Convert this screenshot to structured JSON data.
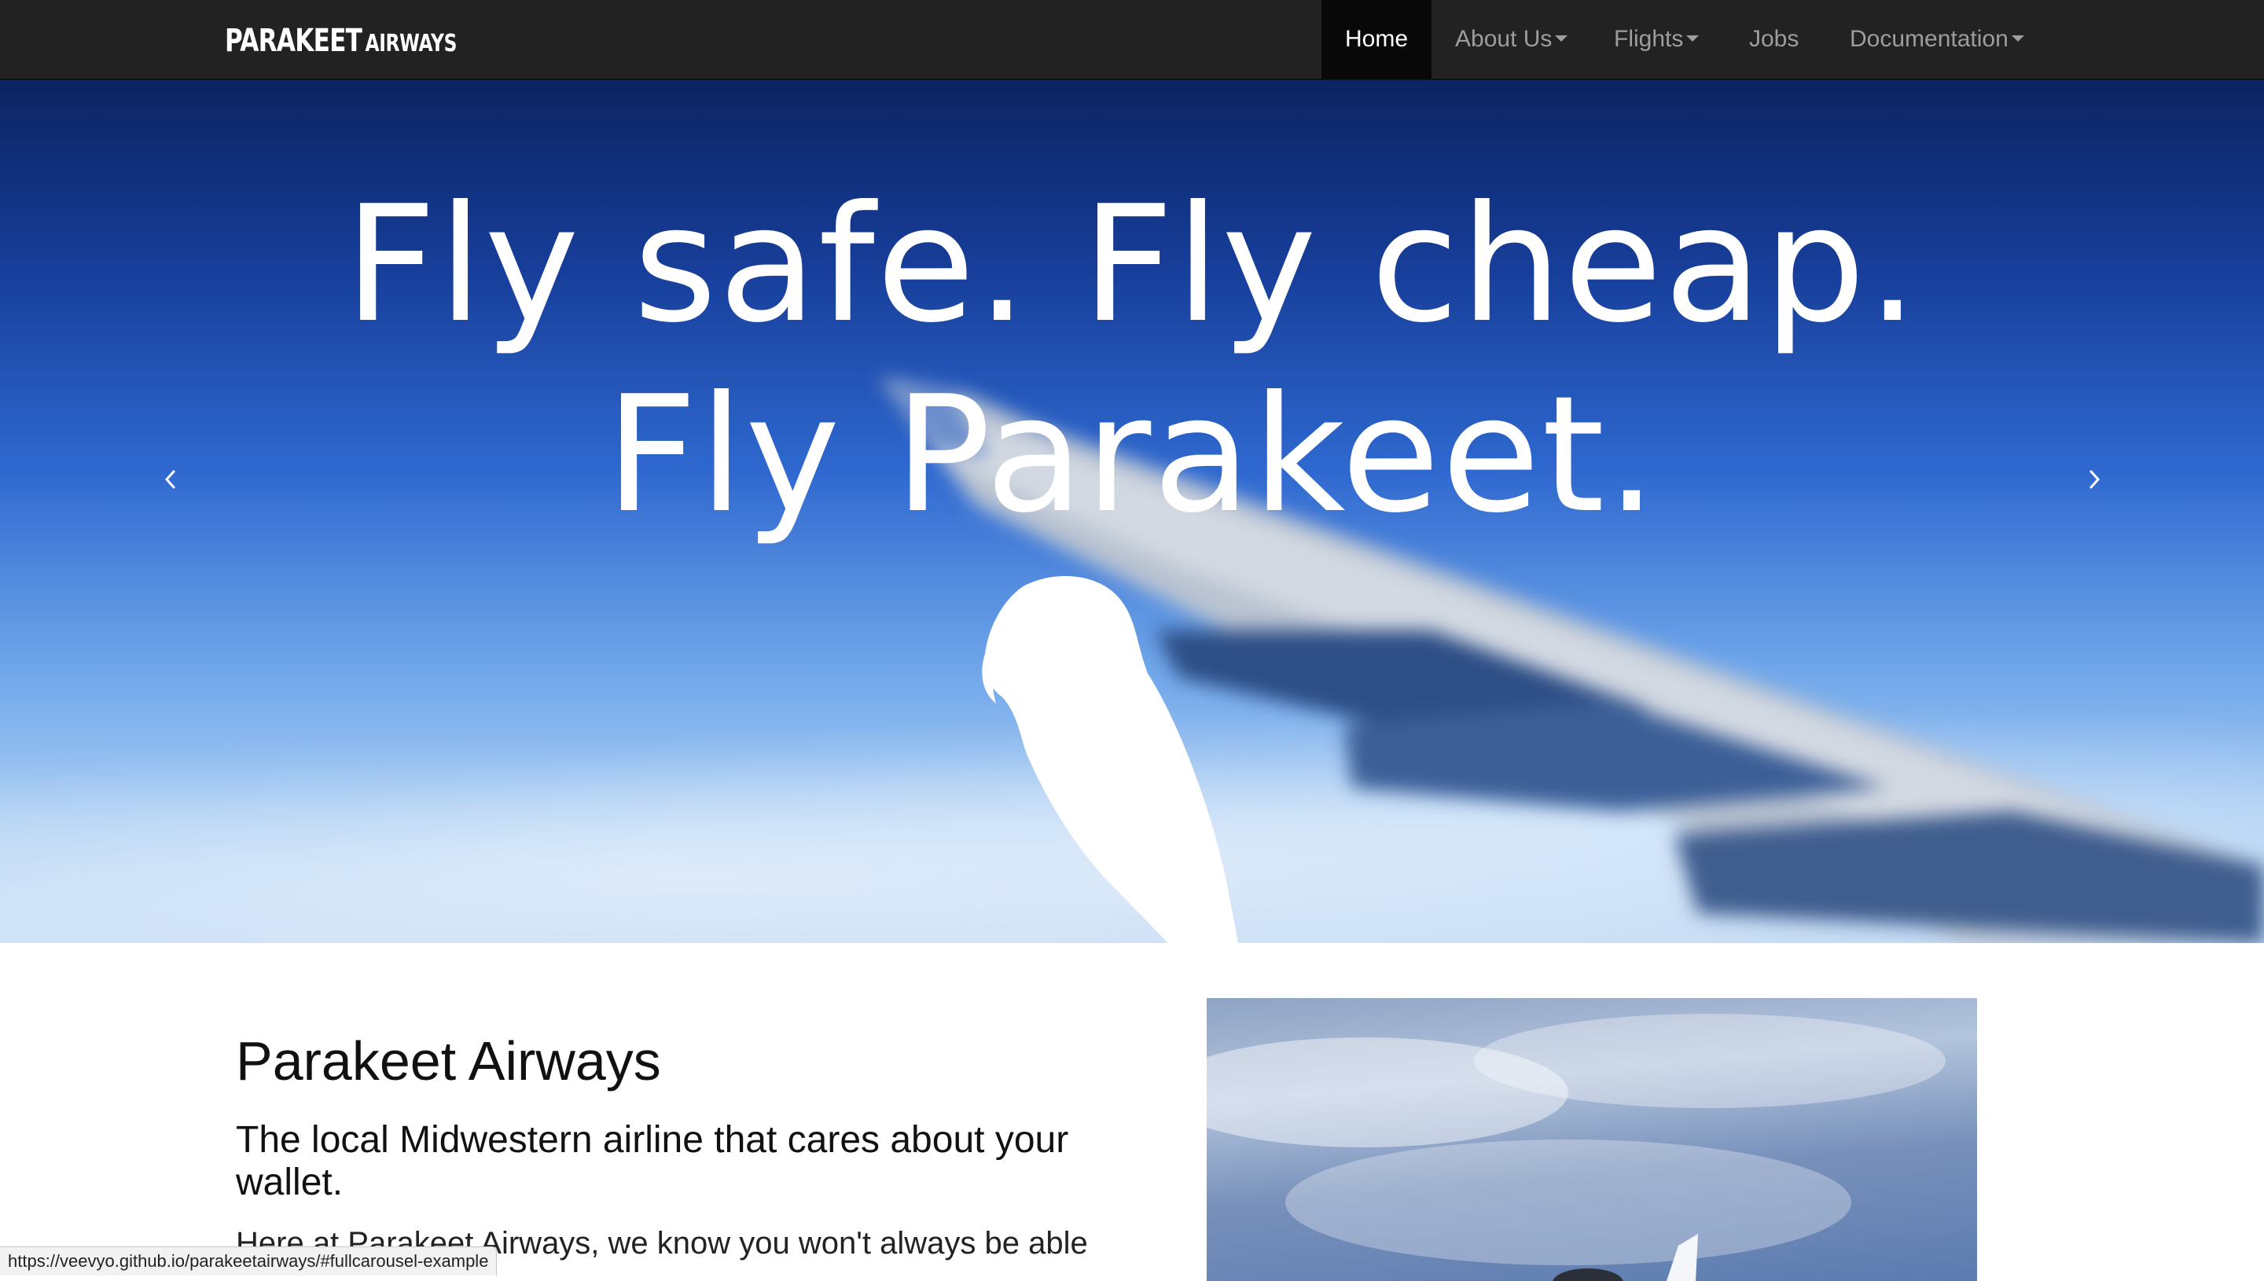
{
  "colors": {
    "navbar_bg": "#222222",
    "nav_active_bg": "#080808",
    "nav_text": "#9d9d9d",
    "hero_text": "#ffffff"
  },
  "navbar": {
    "brand_main": "PARAKEET",
    "brand_sub": "AIRWAYS",
    "items": [
      {
        "label": "Home",
        "active": true,
        "dropdown": false
      },
      {
        "label": "About Us",
        "active": false,
        "dropdown": true
      },
      {
        "label": "Flights",
        "active": false,
        "dropdown": true
      },
      {
        "label": "Jobs",
        "active": false,
        "dropdown": false
      },
      {
        "label": "Documentation",
        "active": false,
        "dropdown": true
      }
    ]
  },
  "hero": {
    "line1": "Fly safe. Fly cheap.",
    "line2": "Fly Parakeet.",
    "prev_icon": "chevron-left-icon",
    "next_icon": "chevron-right-icon",
    "logo_icon": "parakeet-silhouette-icon"
  },
  "intro": {
    "heading": "Parakeet Airways",
    "subheading": "The local Midwestern airline that cares about your wallet.",
    "body": "Here at Parakeet Airways, we know you won't always be able"
  },
  "status_bar": {
    "url": "https://veevyo.github.io/parakeetairways/#fullcarousel-example"
  }
}
